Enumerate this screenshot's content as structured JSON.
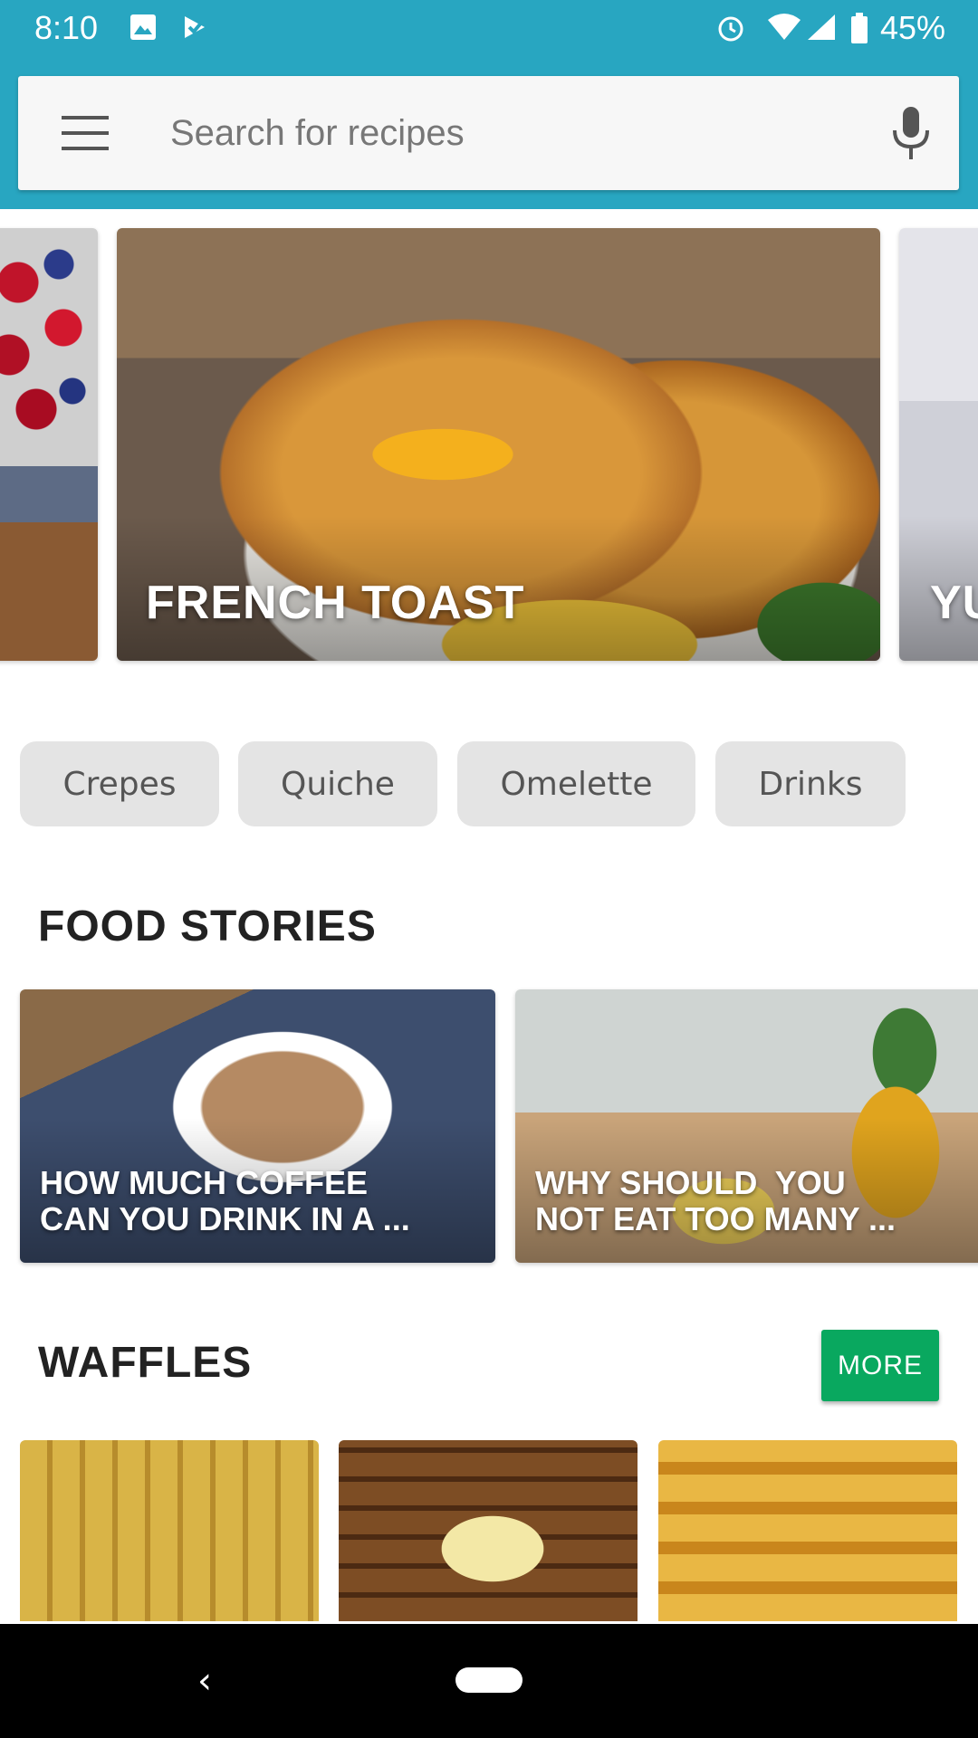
{
  "status_bar": {
    "time": "8:10",
    "battery_percent": "45%",
    "icons": [
      "image-icon",
      "check-icon",
      "alarm-icon",
      "wifi-icon",
      "signal-icon",
      "battery-icon"
    ]
  },
  "search": {
    "placeholder": "Search for recipes",
    "value": ""
  },
  "hero_carousel": {
    "items": [
      {
        "title": ""
      },
      {
        "title": "FRENCH TOAST"
      },
      {
        "title": "YU"
      }
    ]
  },
  "chips": [
    {
      "label": "Crepes"
    },
    {
      "label": "Quiche"
    },
    {
      "label": "Omelette"
    },
    {
      "label": "Drinks"
    }
  ],
  "food_stories": {
    "title": "FOOD STORIES",
    "items": [
      {
        "title_line1": "HOW MUCH COFFEE",
        "title_line2": "CAN YOU DRINK IN A ..."
      },
      {
        "title_line1": "WHY SHOULD  YOU",
        "title_line2": "NOT EAT TOO MANY ..."
      }
    ]
  },
  "waffles": {
    "title": "WAFFLES",
    "more_label": "MORE"
  },
  "colors": {
    "accent": "#28a6c1",
    "more_button": "#09a85f",
    "chip_bg": "#e4e4e4"
  }
}
